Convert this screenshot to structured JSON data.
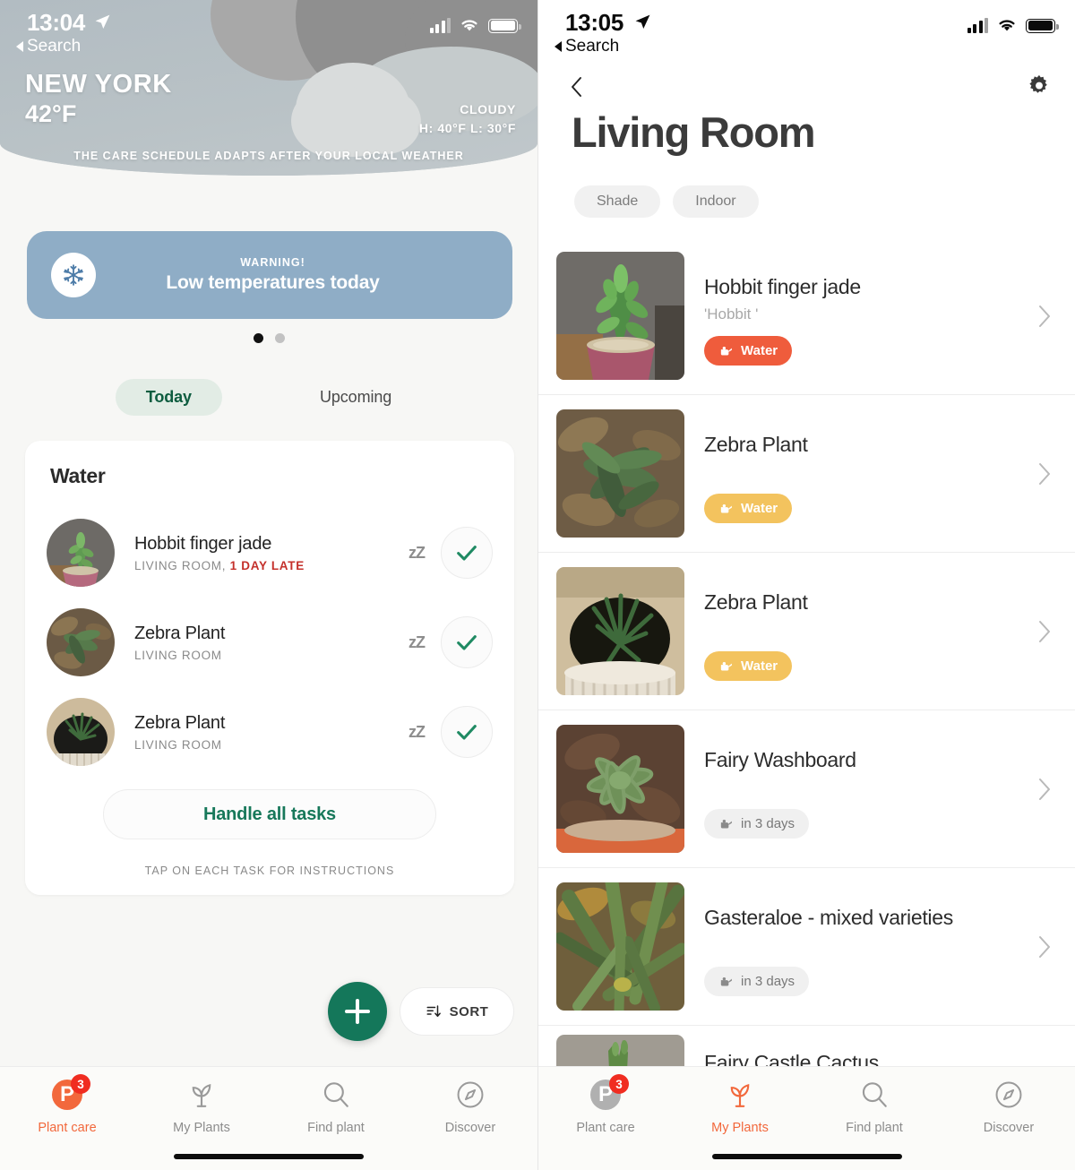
{
  "left": {
    "status": {
      "time": "13:04",
      "back_label": "Search",
      "location_icon": "location-arrow-icon"
    },
    "weather": {
      "city": "NEW YORK",
      "temp": "42°F",
      "condition": "CLOUDY",
      "high_low": "H: 40°F L: 30°F",
      "note": "THE CARE SCHEDULE ADAPTS AFTER YOUR LOCAL WEATHER"
    },
    "warning": {
      "kicker": "WARNING!",
      "title": "Low temperatures today",
      "icon": "snowflake-icon",
      "bg": "#8fadc6"
    },
    "carousel": {
      "total": 2,
      "active": 1
    },
    "tabs": [
      {
        "label": "Today",
        "active": true
      },
      {
        "label": "Upcoming",
        "active": false
      }
    ],
    "task_card": {
      "title": "Water",
      "tasks": [
        {
          "name": "Hobbit finger jade",
          "room": "LIVING ROOM, ",
          "late": "1 DAY LATE",
          "snooze": "zZ",
          "done_icon": "check-icon"
        },
        {
          "name": "Zebra Plant",
          "room": "LIVING ROOM",
          "late": "",
          "snooze": "zZ",
          "done_icon": "check-icon"
        },
        {
          "name": "Zebra Plant",
          "room": "LIVING ROOM",
          "late": "",
          "snooze": "zZ",
          "done_icon": "check-icon"
        }
      ],
      "handle_all_label": "Handle all tasks",
      "hint": "TAP ON EACH TASK FOR INSTRUCTIONS"
    },
    "fab": {
      "icon": "plus-icon"
    },
    "sort": {
      "label": "SORT",
      "icon": "sort-descending-icon"
    },
    "tabbar": [
      {
        "label": "Plant care",
        "icon": "plantcare-logo-icon",
        "badge": "3",
        "active": true
      },
      {
        "label": "My Plants",
        "icon": "seedling-icon",
        "badge": "",
        "active": false
      },
      {
        "label": "Find plant",
        "icon": "search-icon",
        "badge": "",
        "active": false
      },
      {
        "label": "Discover",
        "icon": "compass-icon",
        "badge": "",
        "active": false
      }
    ]
  },
  "right": {
    "status": {
      "time": "13:05",
      "back_label": "Search",
      "location_icon": "location-arrow-icon"
    },
    "nav": {
      "back_icon": "chevron-left-icon",
      "settings_icon": "gear-icon"
    },
    "title": "Living Room",
    "chips": [
      {
        "label": "Shade"
      },
      {
        "label": "Indoor"
      }
    ],
    "plants": [
      {
        "name": "Hobbit finger jade",
        "variety": "'Hobbit '",
        "badge": "Water",
        "badge_style": "orange",
        "badge_icon": "watering-can-icon",
        "chevron": "chevron-right-icon"
      },
      {
        "name": "Zebra Plant",
        "variety": "",
        "badge": "Water",
        "badge_style": "yellow",
        "badge_icon": "watering-can-icon",
        "chevron": "chevron-right-icon"
      },
      {
        "name": "Zebra Plant",
        "variety": "",
        "badge": "Water",
        "badge_style": "yellow",
        "badge_icon": "watering-can-icon",
        "chevron": "chevron-right-icon"
      },
      {
        "name": "Fairy Washboard",
        "variety": "",
        "badge": "in 3 days",
        "badge_style": "grey",
        "badge_icon": "watering-can-icon",
        "chevron": "chevron-right-icon"
      },
      {
        "name": "Gasteraloe - mixed varieties",
        "variety": "",
        "badge": "in 3 days",
        "badge_style": "grey",
        "badge_icon": "watering-can-icon",
        "chevron": "chevron-right-icon"
      },
      {
        "name": "Fairy Castle Cactus",
        "variety": "",
        "badge": "",
        "badge_style": "none",
        "badge_icon": "",
        "chevron": "chevron-right-icon"
      }
    ],
    "tabbar": [
      {
        "label": "Plant care",
        "icon": "plantcare-logo-icon",
        "badge": "3",
        "active": false
      },
      {
        "label": "My Plants",
        "icon": "seedling-icon",
        "badge": "",
        "active": true
      },
      {
        "label": "Find plant",
        "icon": "search-icon",
        "badge": "",
        "active": false
      },
      {
        "label": "Discover",
        "icon": "compass-icon",
        "badge": "",
        "active": false
      }
    ]
  },
  "colors": {
    "accent_orange": "#f2683c",
    "badge_red": "#f02d21",
    "water_orange": "#ef5c3c",
    "water_yellow": "#f3c35e",
    "green": "#14775a",
    "warning_blue": "#8fadc6",
    "late_red": "#c4302b"
  }
}
